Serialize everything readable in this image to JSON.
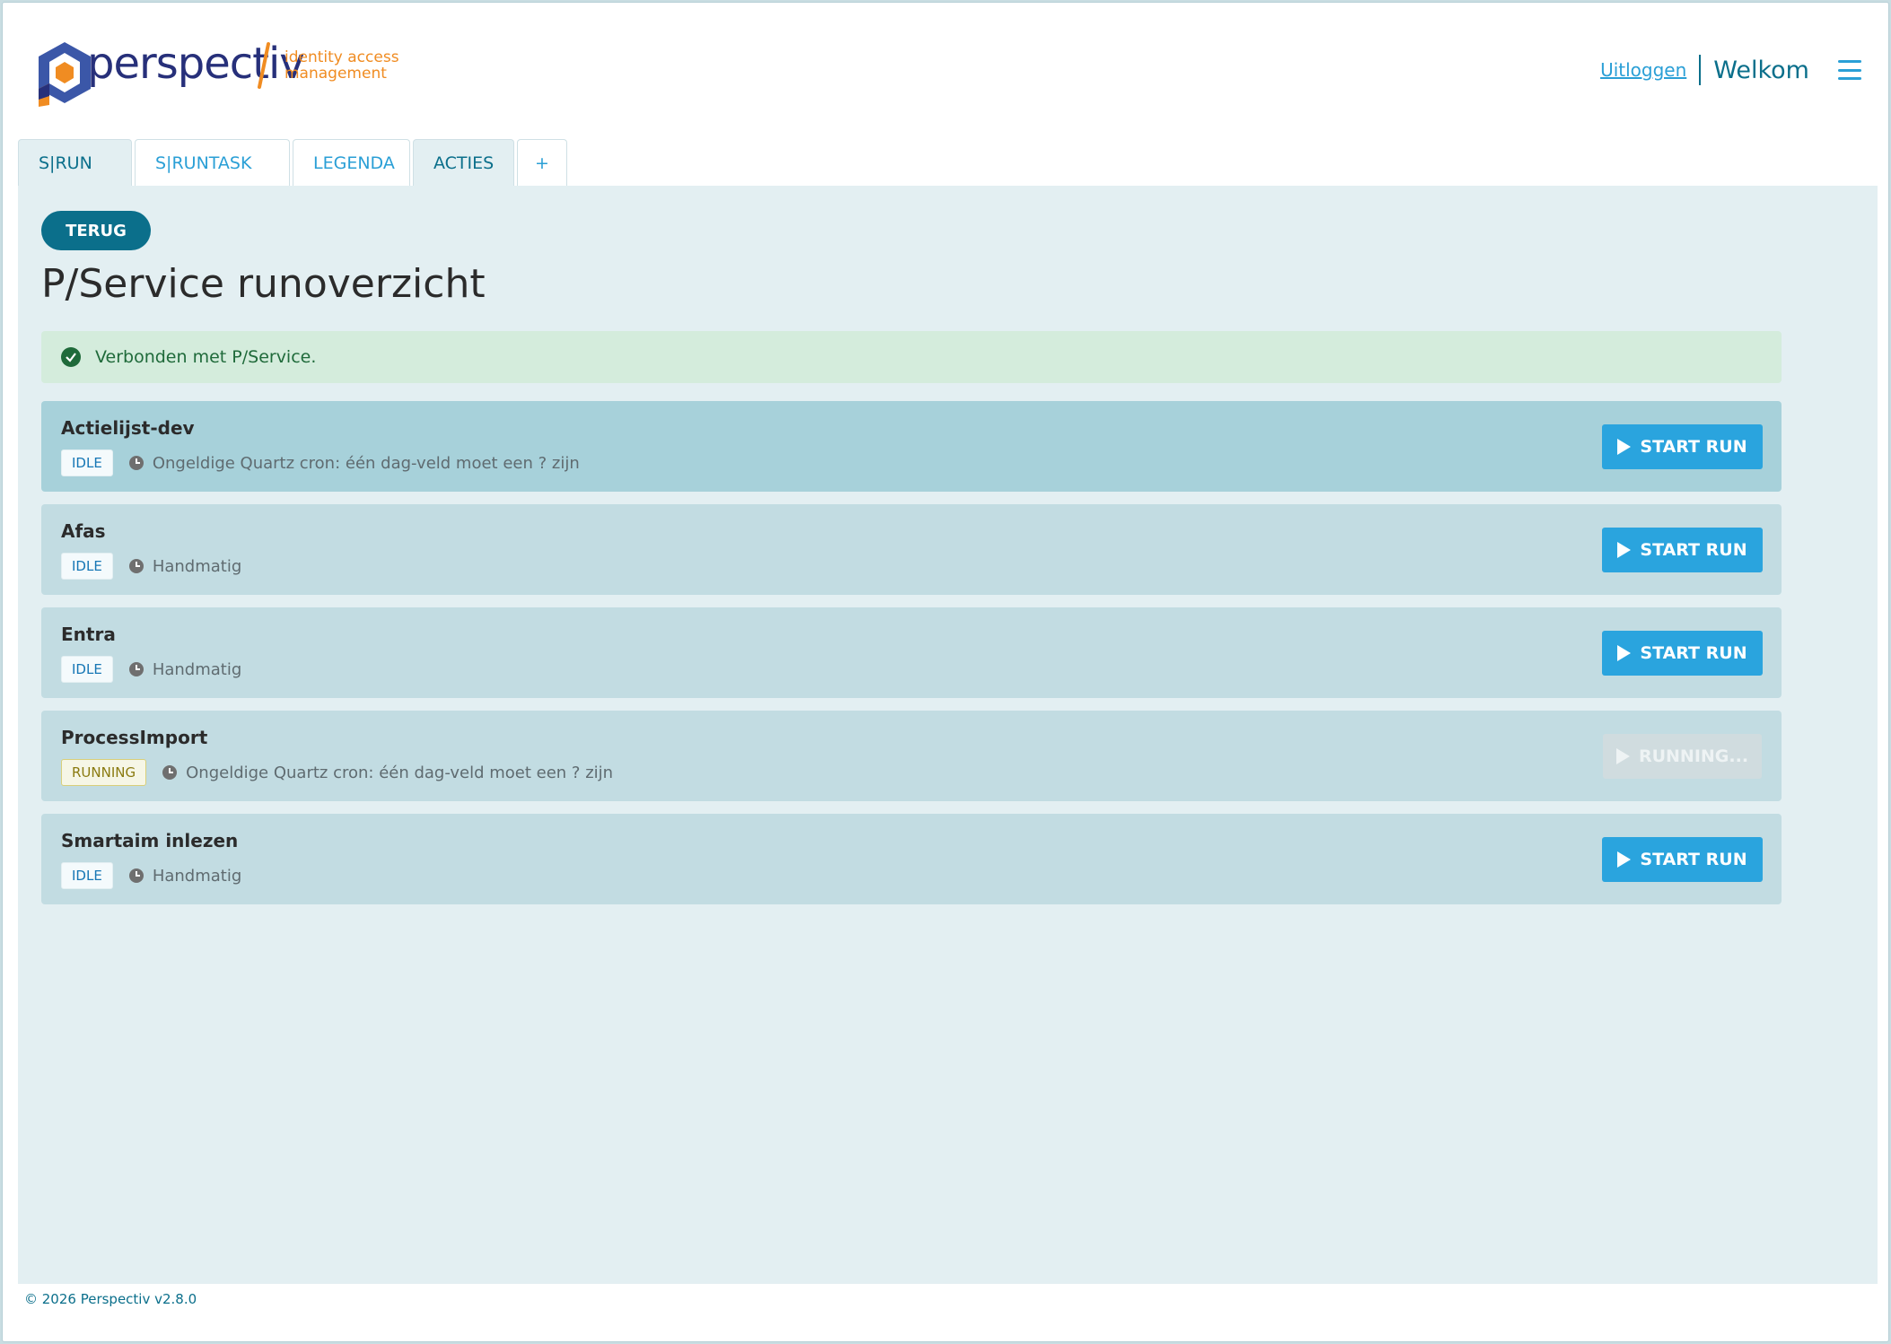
{
  "brand": {
    "name": "perspectiv",
    "tagline_line1": "identity access",
    "tagline_line2": "management",
    "colors": {
      "primary": "#27307a",
      "accent": "#f08c22",
      "teal": "#0b6f8b",
      "button_blue": "#2aa4de"
    }
  },
  "header": {
    "logout_label": "Uitloggen",
    "welcome_label": "Welkom",
    "menu_icon": "hamburger-icon"
  },
  "tabs": [
    {
      "label": "S|RUN",
      "active": true
    },
    {
      "label": "S|RUNTASK",
      "active": false
    },
    {
      "label": "LEGENDA",
      "active": false
    },
    {
      "label": "ACTIES",
      "active": true
    },
    {
      "label": "+",
      "active": false
    }
  ],
  "page": {
    "back_label": "TERUG",
    "title": "P/Service runoverzicht",
    "alert_text": "Verbonden met P/Service.",
    "alert_icon": "check-circle-icon"
  },
  "runs": [
    {
      "name": "Actielijst-dev",
      "status": "IDLE",
      "schedule": "Ongeldige Quartz cron: één dag-veld moet een ? zijn",
      "button": "START RUN",
      "highlight": true
    },
    {
      "name": "Afas",
      "status": "IDLE",
      "schedule": "Handmatig",
      "button": "START RUN",
      "highlight": false
    },
    {
      "name": "Entra",
      "status": "IDLE",
      "schedule": "Handmatig",
      "button": "START RUN",
      "highlight": false
    },
    {
      "name": "ProcessImport",
      "status": "RUNNING",
      "schedule": "Ongeldige Quartz cron: één dag-veld moet een ? zijn",
      "button": "RUNNING...",
      "highlight": false,
      "disabled": true
    },
    {
      "name": "Smartaim inlezen",
      "status": "IDLE",
      "schedule": "Handmatig",
      "button": "START RUN",
      "highlight": false
    }
  ],
  "footer": {
    "text": "© 2026 Perspectiv v2.8.0"
  }
}
